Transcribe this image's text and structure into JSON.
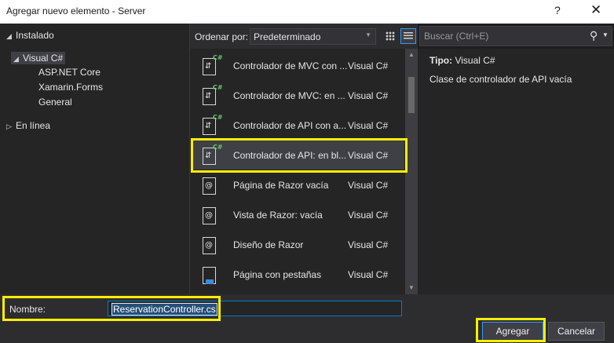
{
  "window": {
    "title": "Agregar nuevo elemento - Server",
    "help_label": "?",
    "close_label": "✕"
  },
  "tree": {
    "installed_label": "Instalado",
    "visual_csharp_label": "Visual C#",
    "children": [
      "ASP.NET Core",
      "Xamarin.Forms",
      "General"
    ],
    "online_label": "En línea"
  },
  "sortbar": {
    "sort_label": "Ordenar por:",
    "sort_value": "Predeterminado"
  },
  "search": {
    "placeholder": "Buscar (Ctrl+E)"
  },
  "templates": [
    {
      "name": "Controlador de MVC con ...",
      "lang": "Visual C#",
      "icon": "csharp-controller-icon"
    },
    {
      "name": "Controlador de MVC: en ...",
      "lang": "Visual C#",
      "icon": "csharp-controller-icon"
    },
    {
      "name": "Controlador de API con a...",
      "lang": "Visual C#",
      "icon": "csharp-controller-icon"
    },
    {
      "name": "Controlador de API: en bl...",
      "lang": "Visual C#",
      "icon": "csharp-controller-icon",
      "selected": true
    },
    {
      "name": "Página de Razor vacía",
      "lang": "Visual C#",
      "icon": "razor-page-icon"
    },
    {
      "name": "Vista de Razor: vacía",
      "lang": "Visual C#",
      "icon": "razor-page-icon"
    },
    {
      "name": "Diseño de Razor",
      "lang": "Visual C#",
      "icon": "razor-page-icon"
    },
    {
      "name": "Página con pestañas",
      "lang": "Visual C#",
      "icon": "tabbed-page-icon"
    }
  ],
  "detail": {
    "type_label": "Tipo:",
    "type_value": "Visual C#",
    "description": "Clase de controlador de API vacía"
  },
  "form": {
    "name_label": "Nombre:",
    "name_value": "ReservationController.cs"
  },
  "buttons": {
    "add_label": "Agregar",
    "cancel_label": "Cancelar"
  },
  "colors": {
    "highlight": "#ffee00",
    "accent": "#3399ff",
    "background": "#1e1e1e"
  }
}
